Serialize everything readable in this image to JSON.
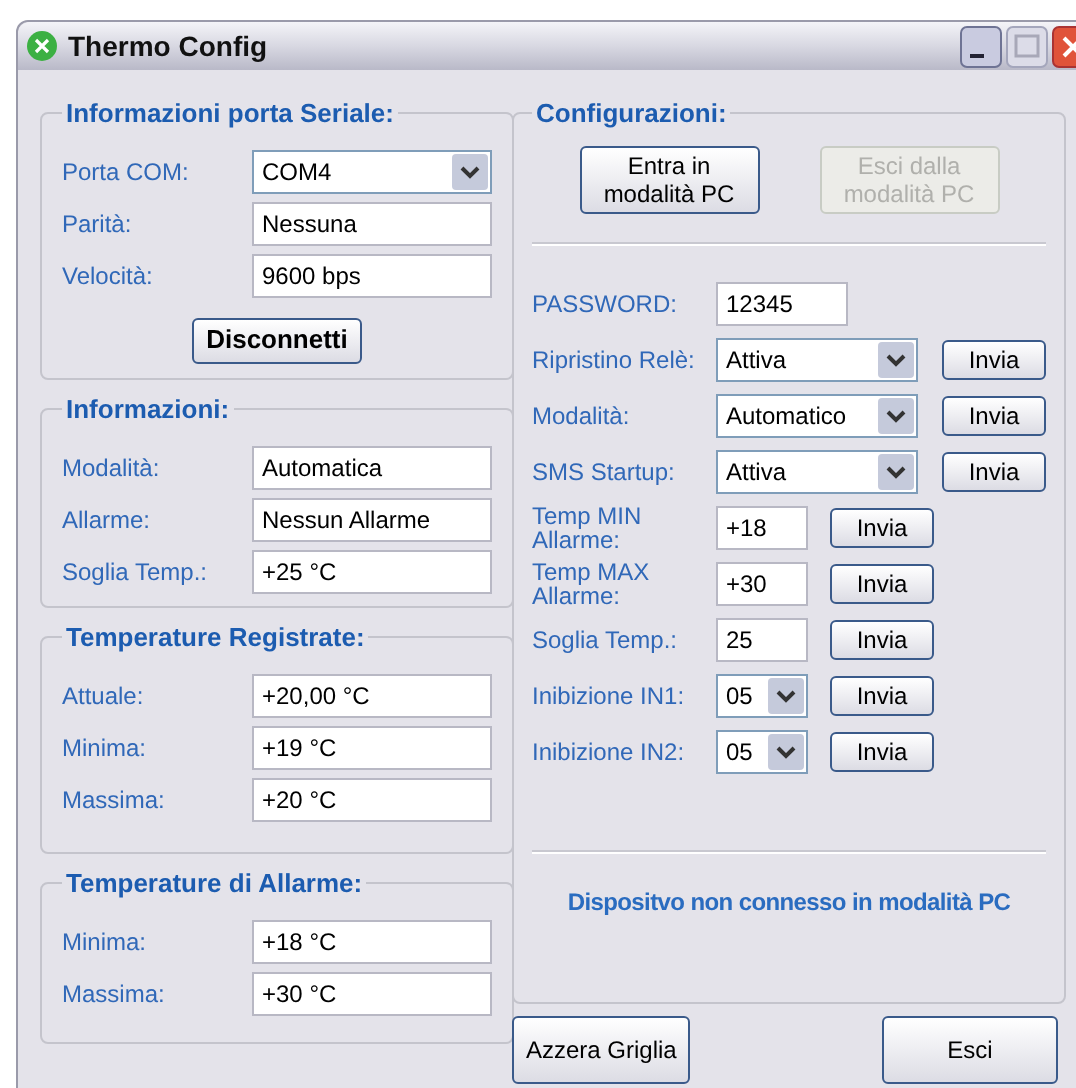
{
  "window": {
    "title": "Thermo Config"
  },
  "left_groups": [
    {
      "title": "Informazioni porta Seriale:",
      "fields": [
        {
          "kind": "combo",
          "label": "Porta COM:",
          "value": "COM4"
        },
        {
          "kind": "text",
          "label": "Parità:",
          "value": "Nessuna"
        },
        {
          "kind": "text",
          "label": "Velocità:",
          "value": "9600 bps"
        }
      ],
      "button": "Disconnetti"
    },
    {
      "title": "Informazioni:",
      "fields": [
        {
          "kind": "text",
          "label": "Modalità:",
          "value": "Automatica"
        },
        {
          "kind": "text",
          "label": "Allarme:",
          "value": "Nessun Allarme"
        },
        {
          "kind": "text",
          "label": "Soglia Temp.:",
          "value": "+25 °C"
        }
      ]
    },
    {
      "title": "Temperature Registrate:",
      "fields": [
        {
          "kind": "text",
          "label": "Attuale:",
          "value": "+20,00 °C"
        },
        {
          "kind": "text",
          "label": "Minima:",
          "value": "+19 °C"
        },
        {
          "kind": "text",
          "label": "Massima:",
          "value": "+20 °C"
        }
      ]
    },
    {
      "title": "Temperature di Allarme:",
      "fields": [
        {
          "kind": "text",
          "label": "Minima:",
          "value": "+18 °C"
        },
        {
          "kind": "text",
          "label": "Massima:",
          "value": "+30 °C"
        }
      ]
    }
  ],
  "config": {
    "title": "Configurazioni:",
    "mode_buttons": [
      {
        "label": "Entra in modalità PC",
        "disabled": false
      },
      {
        "label": "Esci dalla modalità PC",
        "disabled": true
      }
    ],
    "rows": [
      {
        "kind": "password",
        "label": "PASSWORD:",
        "value": "12345"
      },
      {
        "kind": "combo",
        "label": "Ripristino Relè:",
        "value": "Attiva",
        "button": "Invia"
      },
      {
        "kind": "combo",
        "label": "Modalità:",
        "value": "Automatico",
        "button": "Invia"
      },
      {
        "kind": "combo",
        "label": "SMS Startup:",
        "value": "Attiva",
        "button": "Invia"
      },
      {
        "kind": "short",
        "label": "Temp MIN Allarme:",
        "value": "+18",
        "button": "Invia"
      },
      {
        "kind": "short",
        "label": "Temp MAX Allarme:",
        "value": "+30",
        "button": "Invia"
      },
      {
        "kind": "short",
        "label": "Soglia Temp.:",
        "value": "25",
        "button": "Invia"
      },
      {
        "kind": "small_combo",
        "label": "Inibizione IN1:",
        "value": "05",
        "button": "Invia"
      },
      {
        "kind": "small_combo",
        "label": "Inibizione IN2:",
        "value": "05",
        "button": "Invia"
      }
    ],
    "status": "Dispositvo non connesso in modalità PC"
  },
  "bottom_buttons": [
    "Azzera Griglia",
    "Esci"
  ]
}
